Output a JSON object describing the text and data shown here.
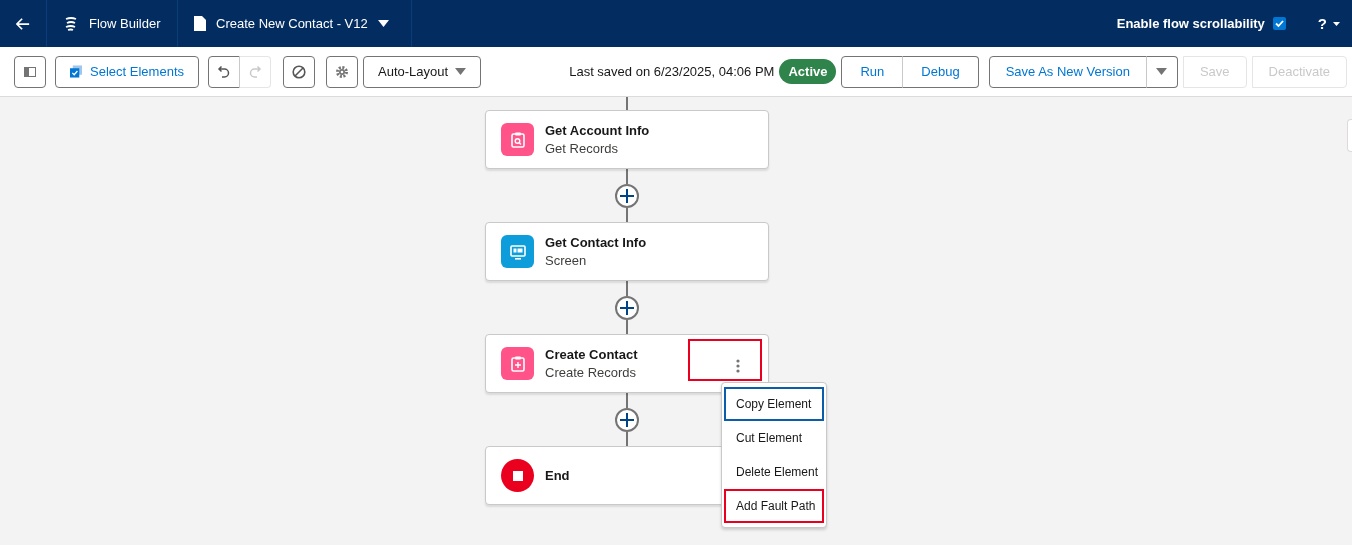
{
  "header": {
    "app_name": "Flow Builder",
    "flow_name": "Create New Contact - V12",
    "scrollability": {
      "label": "Enable flow scrollability",
      "checked": true
    },
    "help": "?"
  },
  "toolbar": {
    "select_elements": "Select Elements",
    "undo": {
      "disabled": false
    },
    "redo": {
      "disabled": true
    },
    "layout": "Auto-Layout",
    "last_saved": "Last saved on 6/23/2025, 04:06 PM",
    "status": "Active",
    "button_groups": [
      {
        "kind": "segmented",
        "buttons": [
          {
            "label": "Run",
            "disabled": false
          },
          {
            "label": "Debug",
            "disabled": false
          }
        ]
      },
      {
        "kind": "split",
        "buttons": [
          {
            "label": "Save As New Version",
            "disabled": false
          }
        ]
      },
      {
        "kind": "single",
        "buttons": [
          {
            "label": "Save",
            "disabled": true
          }
        ]
      },
      {
        "kind": "single",
        "buttons": [
          {
            "label": "Deactivate",
            "disabled": true
          }
        ]
      }
    ]
  },
  "nodes": [
    {
      "kind": "get_records",
      "title": "Get Account Info",
      "subtitle": "Get Records",
      "menu_open": false
    },
    {
      "kind": "screen",
      "title": "Get Contact Info",
      "subtitle": "Screen",
      "menu_open": false
    },
    {
      "kind": "create_records",
      "title": "Create Contact",
      "subtitle": "Create Records",
      "menu_open": true,
      "highlighted": true
    },
    {
      "kind": "end",
      "title": "End",
      "menu_open": false
    }
  ],
  "context_menu": [
    {
      "label": "Copy Element",
      "focused": true,
      "highlighted": false
    },
    {
      "label": "Cut Element",
      "focused": false,
      "highlighted": false
    },
    {
      "label": "Delete Element",
      "focused": false,
      "highlighted": false
    },
    {
      "label": "Add Fault Path",
      "focused": false,
      "highlighted": true
    }
  ]
}
